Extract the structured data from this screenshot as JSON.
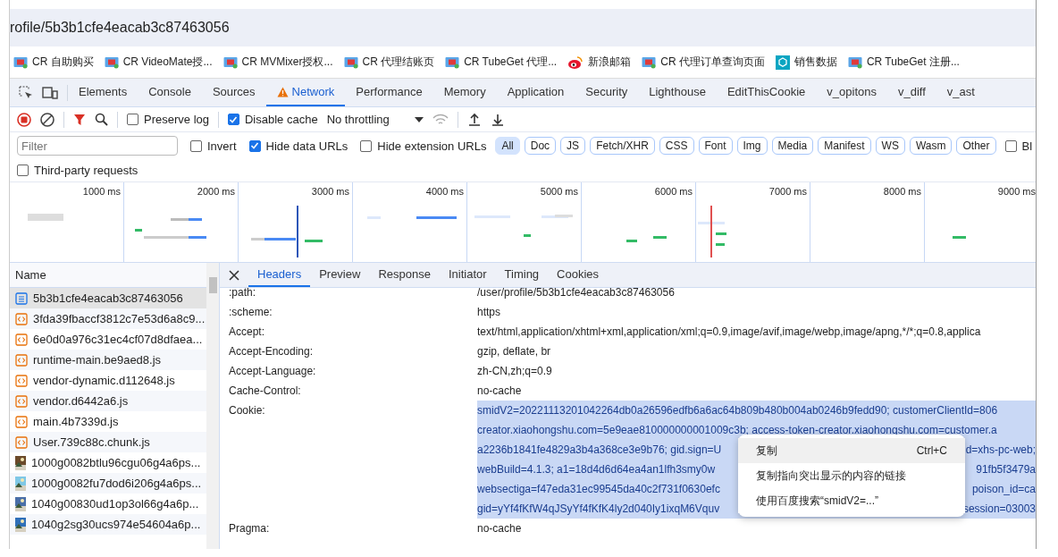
{
  "address_bar": {
    "url": "rofile/5b3b1cfe4eacab3c87463056"
  },
  "bookmarks": [
    {
      "label": "CR 自助购买",
      "kind": "video"
    },
    {
      "label": "CR VideoMate授...",
      "kind": "video"
    },
    {
      "label": "CR MVMixer授权...",
      "kind": "video"
    },
    {
      "label": "CR 代理结账页",
      "kind": "video"
    },
    {
      "label": "CR TubeGet 代理...",
      "kind": "video"
    },
    {
      "label": "新浪邮箱",
      "kind": "weibo"
    },
    {
      "label": "CR 代理订单查询页面",
      "kind": "video"
    },
    {
      "label": "销售数据",
      "kind": "cube"
    },
    {
      "label": "CR TubeGet 注册...",
      "kind": "video"
    }
  ],
  "devtools_tabs": [
    {
      "label": "Elements",
      "selected": false,
      "warning": false
    },
    {
      "label": "Console",
      "selected": false,
      "warning": false
    },
    {
      "label": "Sources",
      "selected": false,
      "warning": false
    },
    {
      "label": "Network",
      "selected": true,
      "warning": true
    },
    {
      "label": "Performance",
      "selected": false,
      "warning": false
    },
    {
      "label": "Memory",
      "selected": false,
      "warning": false
    },
    {
      "label": "Application",
      "selected": false,
      "warning": false
    },
    {
      "label": "Security",
      "selected": false,
      "warning": false
    },
    {
      "label": "Lighthouse",
      "selected": false,
      "warning": false
    },
    {
      "label": "EditThisCookie",
      "selected": false,
      "warning": false
    },
    {
      "label": "v_opitons",
      "selected": false,
      "warning": false
    },
    {
      "label": "v_diff",
      "selected": false,
      "warning": false
    },
    {
      "label": "v_ast",
      "selected": false,
      "warning": false
    }
  ],
  "toolbar": {
    "preserve_log": {
      "label": "Preserve log",
      "checked": false
    },
    "disable_cache": {
      "label": "Disable cache",
      "checked": true
    },
    "throttling": "No throttling"
  },
  "filter": {
    "placeholder": "Filter",
    "options": [
      {
        "label": "Invert",
        "checked": false
      },
      {
        "label": "Hide data URLs",
        "checked": true
      },
      {
        "label": "Hide extension URLs",
        "checked": false
      }
    ],
    "types": [
      {
        "label": "All",
        "selected": true
      },
      {
        "label": "Doc",
        "selected": false
      },
      {
        "label": "JS",
        "selected": false
      },
      {
        "label": "Fetch/XHR",
        "selected": false
      },
      {
        "label": "CSS",
        "selected": false
      },
      {
        "label": "Font",
        "selected": false
      },
      {
        "label": "Img",
        "selected": false
      },
      {
        "label": "Media",
        "selected": false
      },
      {
        "label": "Manifest",
        "selected": false
      },
      {
        "label": "WS",
        "selected": false
      },
      {
        "label": "Wasm",
        "selected": false
      },
      {
        "label": "Other",
        "selected": false
      }
    ],
    "blocked": {
      "label": "Bl",
      "checked": false
    },
    "third_party": {
      "label": "Third-party requests",
      "checked": false
    }
  },
  "timeline": {
    "ticks": [
      "1000 ms",
      "2000 ms",
      "3000 ms",
      "4000 ms",
      "5000 ms",
      "6000 ms",
      "7000 ms",
      "8000 ms",
      "9000 ms"
    ]
  },
  "requests": {
    "column": "Name",
    "rows": [
      {
        "name": "5b3b1cfe4eacab3c87463056",
        "kind": "doc",
        "selected": true
      },
      {
        "name": "3fda39fbaccf3812c7e53d6a8c9...",
        "kind": "script",
        "selected": false
      },
      {
        "name": "6e0d0a976c31ec4cf07d8dfaea...",
        "kind": "script",
        "selected": false
      },
      {
        "name": "runtime-main.be9aed8.js",
        "kind": "script",
        "selected": false
      },
      {
        "name": "vendor-dynamic.d112648.js",
        "kind": "script",
        "selected": false
      },
      {
        "name": "vendor.d6442a6.js",
        "kind": "script",
        "selected": false
      },
      {
        "name": "main.4b7339d.js",
        "kind": "script",
        "selected": false
      },
      {
        "name": "User.739c88c.chunk.js",
        "kind": "script",
        "selected": false
      },
      {
        "name": "1000g0082btlu96cgu06g4a6ps...",
        "selected": false
      },
      {
        "name": "1000g0082fu7dod6i206g4a6ps...",
        "selected": false
      },
      {
        "name": "1040g00830ud1op3ol66g4a6p...",
        "selected": false
      },
      {
        "name": "1040g2sg30ucs974e54604a6p...",
        "selected": false
      }
    ]
  },
  "detail_tabs": [
    {
      "label": "Headers",
      "selected": true
    },
    {
      "label": "Preview",
      "selected": false
    },
    {
      "label": "Response",
      "selected": false
    },
    {
      "label": "Initiator",
      "selected": false
    },
    {
      "label": "Timing",
      "selected": false
    },
    {
      "label": "Cookies",
      "selected": false
    }
  ],
  "headers": [
    {
      "name": ":path:",
      "value": "/user/profile/5b3b1cfe4eacab3c87463056"
    },
    {
      "name": ":scheme:",
      "value": "https"
    },
    {
      "name": "Accept:",
      "value": "text/html,application/xhtml+xml,application/xml;q=0.9,image/avif,image/webp,image/apng,*/*;q=0.8,applica"
    },
    {
      "name": "Accept-Encoding:",
      "value": "gzip, deflate, br"
    },
    {
      "name": "Accept-Language:",
      "value": "zh-CN,zh;q=0.9"
    },
    {
      "name": "Cache-Control:",
      "value": "no-cache"
    },
    {
      "name": "Cookie:",
      "selected_lines": [
        {
          "left": "smidV2=20221113201042264db0a26596edfb6a6ac64b809b480b004ab0246b9fedd90; customerClientId=806"
        },
        {
          "left": "creator.xiaohongshu.com=5e9eae810000000001009c3b; access-token-creator.xiaohongshu.com=customer.a"
        },
        {
          "left": "a2236b1841fe4829a3b4a368ce3e9b76; gid.sign=U",
          "right": "d=xhs-pc-web;"
        },
        {
          "left": "webBuild=4.1.3; a1=18d4d6d64ea4an1lfh3smy0w",
          "right": "91fb5f3479a"
        },
        {
          "left": "websectiga=f47eda31ec99545da40c2f731f0630efc",
          "right": "poison_id=ca"
        },
        {
          "left": "gid=yYf4fKfW4qJSyYf4fKfK4ly2d040Iy1ixqM6Vquv",
          "right": "session=03003"
        }
      ]
    },
    {
      "name": "Pragma:",
      "value": "no-cache"
    }
  ],
  "context_menu": [
    {
      "label": "复制",
      "shortcut": "Ctrl+C",
      "selected": true
    },
    {
      "label": "复制指向突出显示的内容的链接",
      "selected": false
    },
    {
      "label": "使用百度搜索“smidV2=...”",
      "selected": false
    }
  ]
}
